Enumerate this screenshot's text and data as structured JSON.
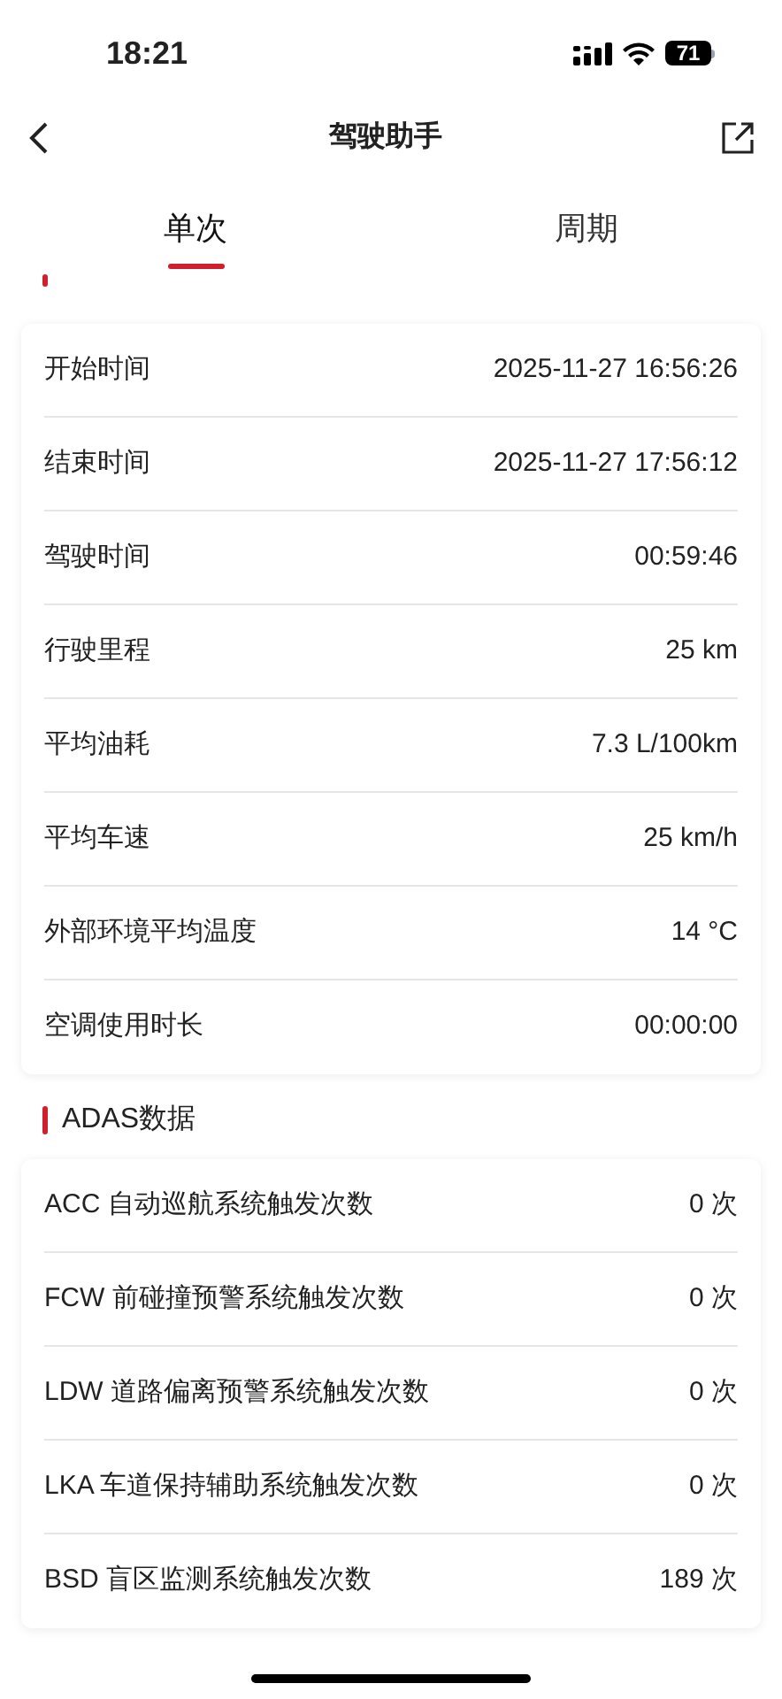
{
  "status_bar": {
    "time": "18:21",
    "battery": "71"
  },
  "header": {
    "title": "驾驶助手"
  },
  "tabs": [
    {
      "label": "单次",
      "selected": true
    },
    {
      "label": "周期",
      "selected": false
    }
  ],
  "sections": [
    {
      "rows": [
        {
          "label": "开始时间",
          "value": "2025-11-27 16:56:26"
        },
        {
          "label": "结束时间",
          "value": "2025-11-27 17:56:12"
        },
        {
          "label": "驾驶时间",
          "value": "00:59:46"
        },
        {
          "label": "行驶里程",
          "value": "25 km"
        },
        {
          "label": "平均油耗",
          "value": "7.3 L/100km"
        },
        {
          "label": "平均车速",
          "value": "25 km/h"
        },
        {
          "label": "外部环境平均温度",
          "value": "14 °C"
        },
        {
          "label": "空调使用时长",
          "value": "00:00:00"
        }
      ]
    },
    {
      "title": "ADAS数据",
      "rows": [
        {
          "label": "ACC 自动巡航系统触发次数",
          "value": "0 次"
        },
        {
          "label": "FCW 前碰撞预警系统触发次数",
          "value": "0 次"
        },
        {
          "label": "LDW 道路偏离预警系统触发次数",
          "value": "0 次"
        },
        {
          "label": "LKA 车道保持辅助系统触发次数",
          "value": "0 次"
        },
        {
          "label": "BSD 盲区监测系统触发次数",
          "value": "189 次"
        }
      ]
    }
  ]
}
